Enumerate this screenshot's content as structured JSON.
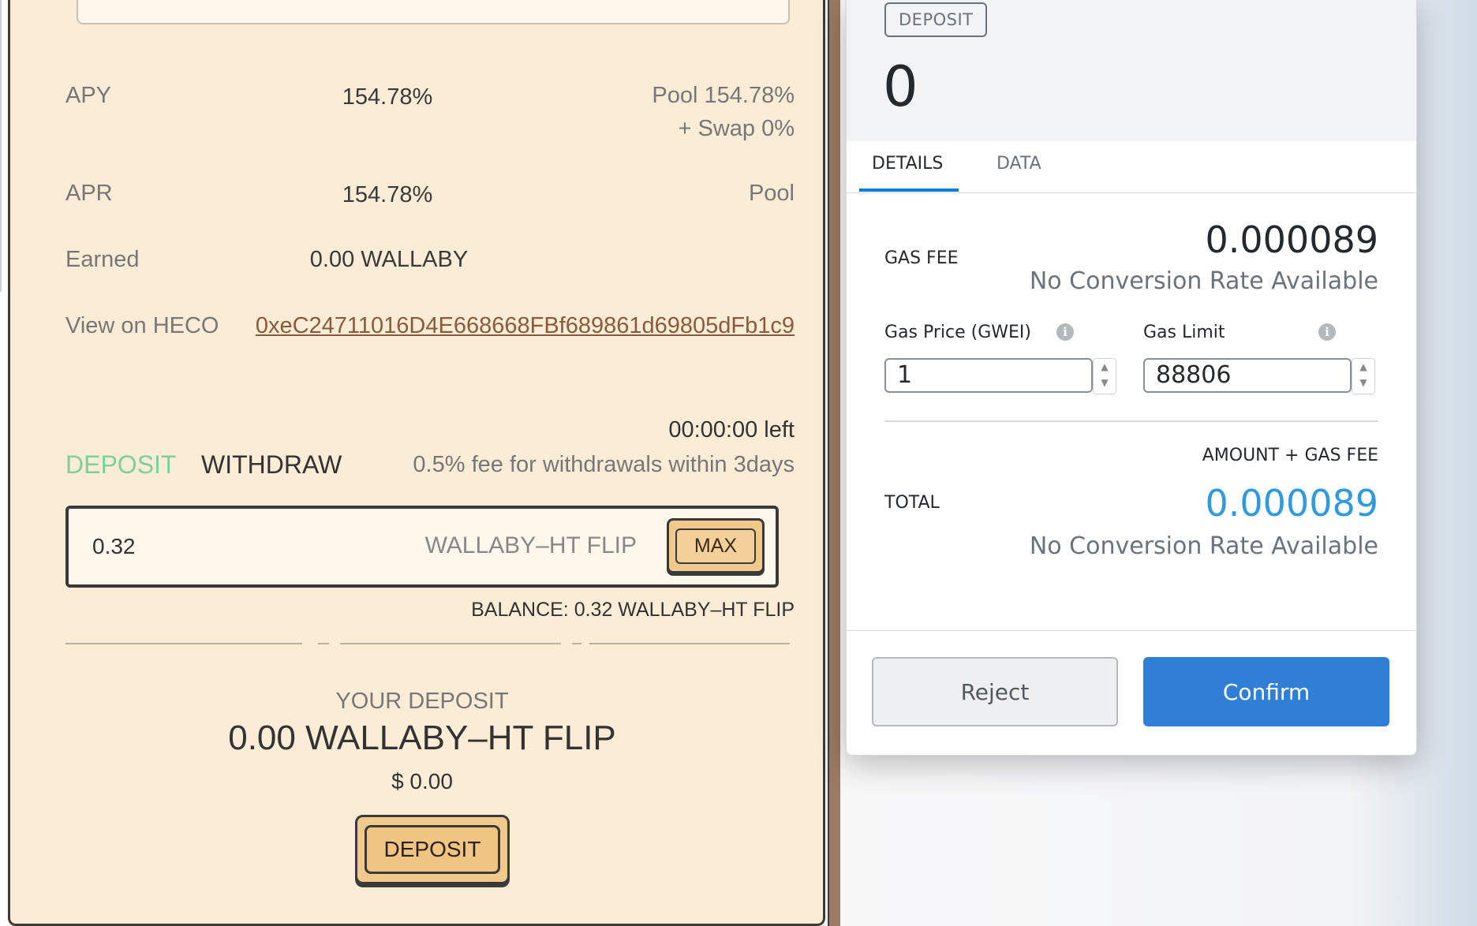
{
  "farm": {
    "apy": {
      "label": "APY",
      "value": "154.78%",
      "detail_line1": "Pool 154.78%",
      "detail_line2": "+ Swap 0%"
    },
    "apr": {
      "label": "APR",
      "value": "154.78%",
      "detail": "Pool"
    },
    "earned": {
      "label": "Earned",
      "value": "0.00 WALLABY"
    },
    "view": {
      "label": "View on HECO",
      "address": "0xeC24711016D4E668668FBf689861d69805dFb1c9"
    },
    "timer": "00:00:00 left",
    "tabs": {
      "deposit": "DEPOSIT",
      "withdraw": "WITHDRAW"
    },
    "fee_note": "0.5% fee for withdrawals within 3days",
    "amount_input": {
      "value": "0.32",
      "token": "WALLABY–HT FLIP",
      "max_label": "MAX"
    },
    "balance": "BALANCE: 0.32 WALLABY–HT FLIP",
    "your_deposit": {
      "label": "YOUR DEPOSIT",
      "amount": "0.00 WALLABY–HT FLIP",
      "usd": "$ 0.00"
    },
    "deposit_button": "DEPOSIT"
  },
  "popup": {
    "tag": "DEPOSIT",
    "amount": "0",
    "tabs": {
      "details": "DETAILS",
      "data": "DATA"
    },
    "gas_fee": {
      "label": "GAS FEE",
      "value": "0.000089",
      "conversion": "No Conversion Rate Available"
    },
    "gas_price": {
      "label": "Gas Price (GWEI)",
      "value": "1"
    },
    "gas_limit": {
      "label": "Gas Limit",
      "value": "88806"
    },
    "amount_gas_label": "AMOUNT + GAS FEE",
    "total": {
      "label": "TOTAL",
      "value": "0.000089",
      "conversion": "No Conversion Rate Available"
    },
    "reject_label": "Reject",
    "confirm_label": "Confirm",
    "colors": {
      "confirm": "#2f7fd6",
      "total": "#2f9ae0",
      "accent_tab": "#037dd6"
    }
  }
}
